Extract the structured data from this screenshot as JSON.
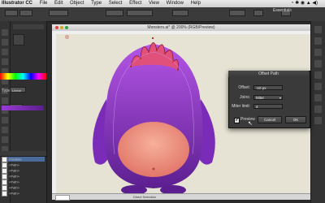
{
  "menubar": {
    "app": "Illustrator CC",
    "items": [
      "File",
      "Edit",
      "Object",
      "Type",
      "Select",
      "Effect",
      "View",
      "Window",
      "Help"
    ],
    "right": "Essentials"
  },
  "document": {
    "title": "Monsters.ai* @ 200% (RGB/Preview)",
    "status_mode": "Direct Selection"
  },
  "left_panel": {
    "type_label": "Type",
    "type_value": "Linear",
    "layers": [
      "Creature",
      "<Path>",
      "<Path>",
      "<Path>",
      "<Path>",
      "<Path>",
      "<Path>"
    ]
  },
  "dialog": {
    "title": "Offset Path",
    "offset_label": "Offset:",
    "offset_value": "-10 px",
    "joins_label": "Joins:",
    "joins_value": "Miter",
    "miter_label": "Miter limit:",
    "miter_value": "4",
    "preview_label": "Preview",
    "preview_checked": "✔",
    "cancel_label": "Cancel",
    "ok_label": "OK"
  },
  "colors": {
    "monster_top": "#9a3bd6",
    "monster_bottom": "#5a1e8c",
    "belly": "#f19a84",
    "canvas_bg": "#e6e3d4"
  }
}
